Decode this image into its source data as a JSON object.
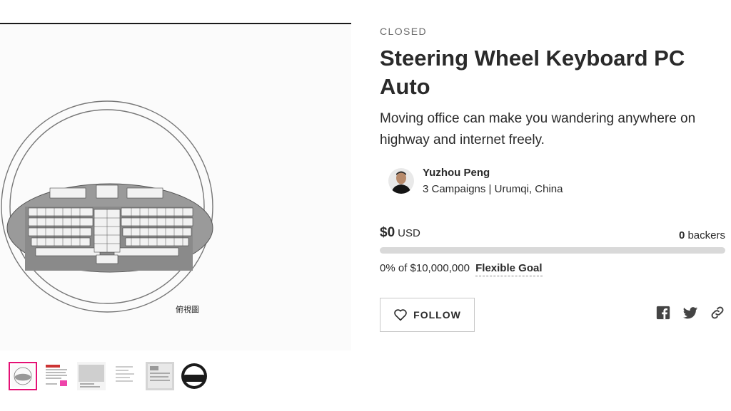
{
  "campaign": {
    "status": "CLOSED",
    "title": "Steering Wheel Keyboard PC Auto",
    "tagline": "Moving office can make you wandering anywhere on highway and internet freely.",
    "hero_caption": "俯視圖"
  },
  "owner": {
    "name": "Yuzhou Peng",
    "meta": "3 Campaigns | Urumqi, China"
  },
  "funding": {
    "amount": "$0",
    "currency": "USD",
    "backers_count": "0",
    "backers_label": "backers",
    "progress_fraction": 0,
    "percent_text": "0% of $10,000,000",
    "goal_type": "Flexible Goal"
  },
  "actions": {
    "follow_label": "FOLLOW"
  },
  "share": [
    "facebook-icon",
    "twitter-icon",
    "link-icon"
  ],
  "colors": {
    "accent": "#e51075",
    "progress_track": "#d9d9d9",
    "text": "#2a2a2a"
  }
}
